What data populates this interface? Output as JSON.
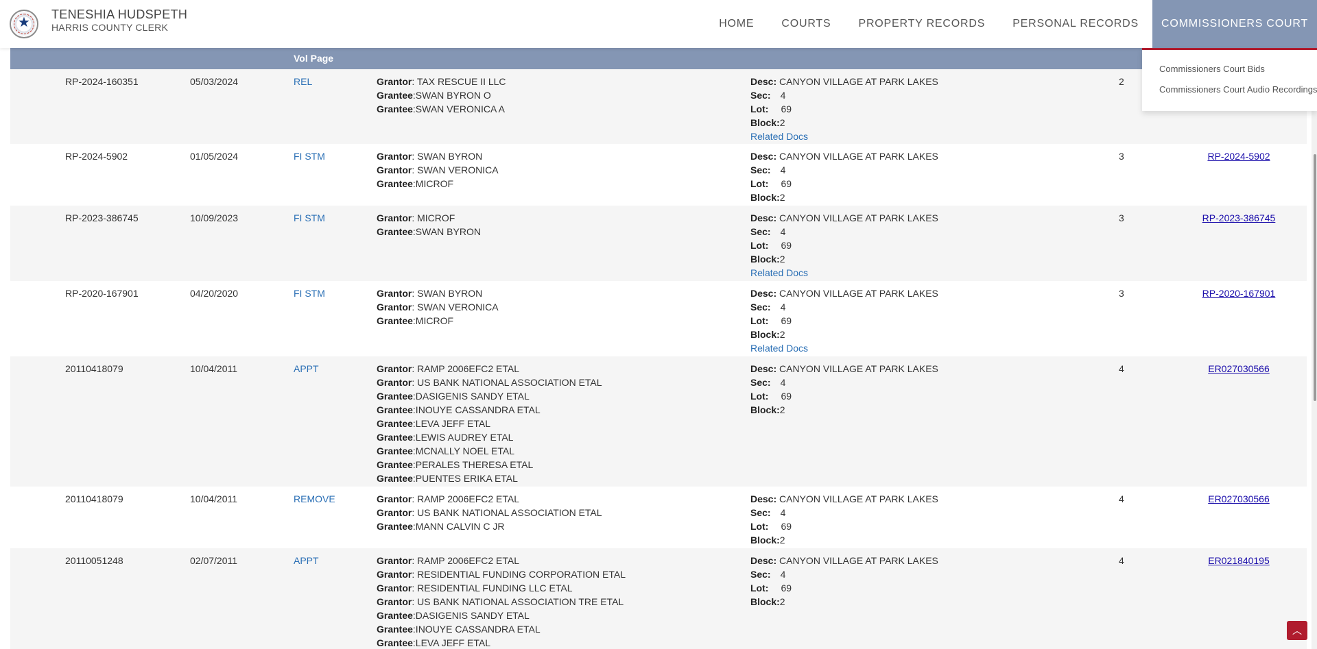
{
  "header": {
    "name": "TENESHIA HUDSPETH",
    "subtitle": "HARRIS COUNTY CLERK",
    "nav": [
      "HOME",
      "COURTS",
      "PROPERTY RECORDS",
      "PERSONAL RECORDS",
      "COMMISSIONERS COURT"
    ]
  },
  "dropdown": [
    "Commissioners Court Bids",
    "Commissioners Court Audio Recordings"
  ],
  "table": {
    "headers": {
      "type_vol": "Vol Page"
    },
    "rows": [
      {
        "file": "RP-2024-160351",
        "date": "05/03/2024",
        "type": "REL",
        "names": [
          [
            "Grantor",
            ": TAX RESCUE II LLC"
          ],
          [
            "Grantee",
            ":SWAN BYRON O"
          ],
          [
            "Grantee",
            ":SWAN VERONICA A"
          ]
        ],
        "desc": "CANYON VILLAGE AT PARK LAKES",
        "sec": "4",
        "lot": "69",
        "block": "2",
        "related": "Related Docs",
        "pages": "2",
        "film": ""
      },
      {
        "file": "RP-2024-5902",
        "date": "01/05/2024",
        "type": "FI STM",
        "names": [
          [
            "Grantor",
            ": SWAN BYRON"
          ],
          [
            "Grantor",
            ": SWAN VERONICA"
          ],
          [
            "Grantee",
            ":MICROF"
          ]
        ],
        "desc": "CANYON VILLAGE AT PARK LAKES",
        "sec": "4",
        "lot": "69",
        "block": "2",
        "related": "",
        "pages": "3",
        "film": "RP-2024-5902"
      },
      {
        "file": "RP-2023-386745",
        "date": "10/09/2023",
        "type": "FI STM",
        "names": [
          [
            "Grantor",
            ": MICROF"
          ],
          [
            "Grantee",
            ":SWAN BYRON"
          ]
        ],
        "desc": "CANYON VILLAGE AT PARK LAKES",
        "sec": "4",
        "lot": "69",
        "block": "2",
        "related": "Related Docs",
        "pages": "3",
        "film": "RP-2023-386745"
      },
      {
        "file": "RP-2020-167901",
        "date": "04/20/2020",
        "type": "FI STM",
        "names": [
          [
            "Grantor",
            ": SWAN BYRON"
          ],
          [
            "Grantor",
            ": SWAN VERONICA"
          ],
          [
            "Grantee",
            ":MICROF"
          ]
        ],
        "desc": "CANYON VILLAGE AT PARK LAKES",
        "sec": "4",
        "lot": "69",
        "block": "2",
        "related": "Related Docs",
        "pages": "3",
        "film": "RP-2020-167901"
      },
      {
        "file": "20110418079",
        "date": "10/04/2011",
        "type": "APPT",
        "names": [
          [
            "Grantor",
            ": RAMP 2006EFC2 ETAL"
          ],
          [
            "Grantor",
            ": US BANK NATIONAL ASSOCIATION ETAL"
          ],
          [
            "Grantee",
            ":DASIGENIS SANDY ETAL"
          ],
          [
            "Grantee",
            ":INOUYE CASSANDRA ETAL"
          ],
          [
            "Grantee",
            ":LEVA JEFF ETAL"
          ],
          [
            "Grantee",
            ":LEWIS AUDREY ETAL"
          ],
          [
            "Grantee",
            ":MCNALLY NOEL ETAL"
          ],
          [
            "Grantee",
            ":PERALES THERESA ETAL"
          ],
          [
            "Grantee",
            ":PUENTES ERIKA ETAL"
          ]
        ],
        "desc": "CANYON VILLAGE AT PARK LAKES",
        "sec": "4",
        "lot": "69",
        "block": "2",
        "related": "",
        "pages": "4",
        "film": "ER027030566"
      },
      {
        "file": "20110418079",
        "date": "10/04/2011",
        "type": "REMOVE",
        "names": [
          [
            "Grantor",
            ": RAMP 2006EFC2 ETAL"
          ],
          [
            "Grantor",
            ": US BANK NATIONAL ASSOCIATION ETAL"
          ],
          [
            "Grantee",
            ":MANN CALVIN C JR"
          ]
        ],
        "desc": "CANYON VILLAGE AT PARK LAKES",
        "sec": "4",
        "lot": "69",
        "block": "2",
        "related": "",
        "pages": "4",
        "film": "ER027030566"
      },
      {
        "file": "20110051248",
        "date": "02/07/2011",
        "type": "APPT",
        "names": [
          [
            "Grantor",
            ": RAMP 2006EFC2 ETAL"
          ],
          [
            "Grantor",
            ": RESIDENTIAL FUNDING CORPORATION ETAL"
          ],
          [
            "Grantor",
            ": RESIDENTIAL FUNDING LLC ETAL"
          ],
          [
            "Grantor",
            ": US BANK NATIONAL ASSOCIATION TRE ETAL"
          ],
          [
            "Grantee",
            ":DASIGENIS SANDY ETAL"
          ],
          [
            "Grantee",
            ":INOUYE CASSANDRA ETAL"
          ],
          [
            "Grantee",
            ":LEVA JEFF ETAL"
          ]
        ],
        "desc": "CANYON VILLAGE AT PARK LAKES",
        "sec": "4",
        "lot": "69",
        "block": "2",
        "related": "",
        "pages": "4",
        "film": "ER021840195"
      }
    ]
  },
  "legal_labels": {
    "desc": "Desc:",
    "sec": "Sec:",
    "lot": "Lot:",
    "block": "Block:"
  },
  "colors": {
    "header_bar": "#8496b4",
    "accent_red": "#b01c2e",
    "link_blue": "#2a6fb5"
  }
}
